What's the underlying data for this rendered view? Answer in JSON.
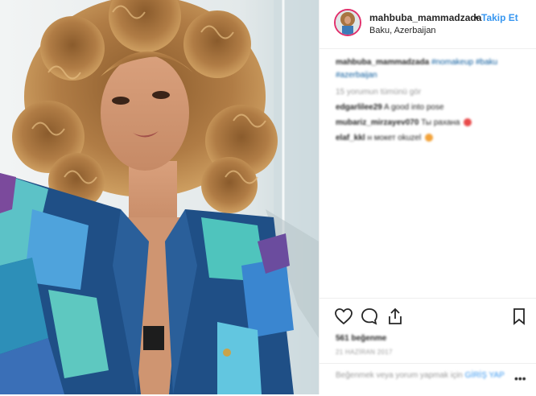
{
  "post": {
    "username": "mahbuba_mammadzada",
    "separator": "•",
    "follow_label": "Takip Et",
    "location": "Baku, Azerbaijan"
  },
  "caption": {
    "username": "mahbuba_mammadzada",
    "hashtags_line1": "#nomakeup #baku",
    "hashtags_line2": "#azerbaijan"
  },
  "view_all_comments": "15 yorumun tümünü gör",
  "comments": [
    {
      "user": "edgarlilee29",
      "text": "A good into pose",
      "emoji": ""
    },
    {
      "user": "mubariz_mirzayev070",
      "text": "Ты рахана",
      "emoji": "red"
    },
    {
      "user": "elaf_kkl",
      "text": "ʜ мокет okuzel",
      "emoji": "orange"
    }
  ],
  "likes": "561 beğenme",
  "date": "21 HAZİRAN 2017",
  "login_prompt": {
    "text": "Beğenmek veya yorum yapmak için",
    "link": "GİRİŞ YAP"
  },
  "more_glyph": "•••",
  "icons": {
    "like": "heart-icon",
    "comment": "comment-icon",
    "share": "share-icon",
    "save": "bookmark-icon",
    "more": "more-options-icon"
  },
  "colors": {
    "link_blue": "#3897f0",
    "text_dark": "#262626",
    "text_muted": "#999999",
    "story_ring": "#e1306c"
  }
}
